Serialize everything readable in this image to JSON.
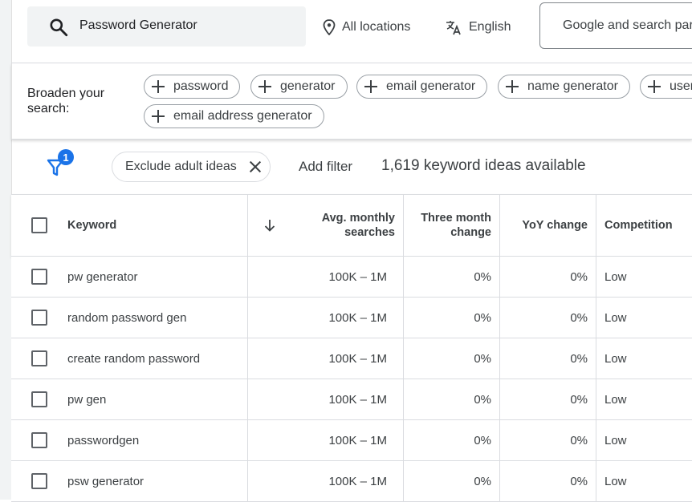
{
  "search": {
    "value": "Password Generator"
  },
  "location": {
    "label": "All locations"
  },
  "language": {
    "label": "English"
  },
  "network": {
    "label": "Google and search partners"
  },
  "broaden": {
    "label": "Broaden your search:",
    "chips": [
      "password",
      "generator",
      "email generator",
      "name generator",
      "user",
      "email address generator"
    ]
  },
  "filters": {
    "badge_count": "1",
    "exclude_chip": "Exclude adult ideas",
    "add_filter": "Add filter",
    "ideas_count": "1,619 keyword ideas available"
  },
  "table": {
    "headers": {
      "keyword": "Keyword",
      "avg": "Avg. monthly searches",
      "three_month": "Three month change",
      "yoy": "YoY change",
      "competition": "Competition"
    },
    "rows": [
      {
        "keyword": "pw generator",
        "avg": "100K – 1M",
        "three_month": "0%",
        "yoy": "0%",
        "competition": "Low"
      },
      {
        "keyword": "random password gen",
        "avg": "100K – 1M",
        "three_month": "0%",
        "yoy": "0%",
        "competition": "Low"
      },
      {
        "keyword": "create random password",
        "avg": "100K – 1M",
        "three_month": "0%",
        "yoy": "0%",
        "competition": "Low"
      },
      {
        "keyword": "pw gen",
        "avg": "100K – 1M",
        "three_month": "0%",
        "yoy": "0%",
        "competition": "Low"
      },
      {
        "keyword": "passwordgen",
        "avg": "100K – 1M",
        "three_month": "0%",
        "yoy": "0%",
        "competition": "Low"
      },
      {
        "keyword": "psw generator",
        "avg": "100K – 1M",
        "three_month": "0%",
        "yoy": "0%",
        "competition": "Low"
      }
    ]
  },
  "colors": {
    "accent": "#1a73e8",
    "border": "#dadce0",
    "text": "#3c4043"
  }
}
